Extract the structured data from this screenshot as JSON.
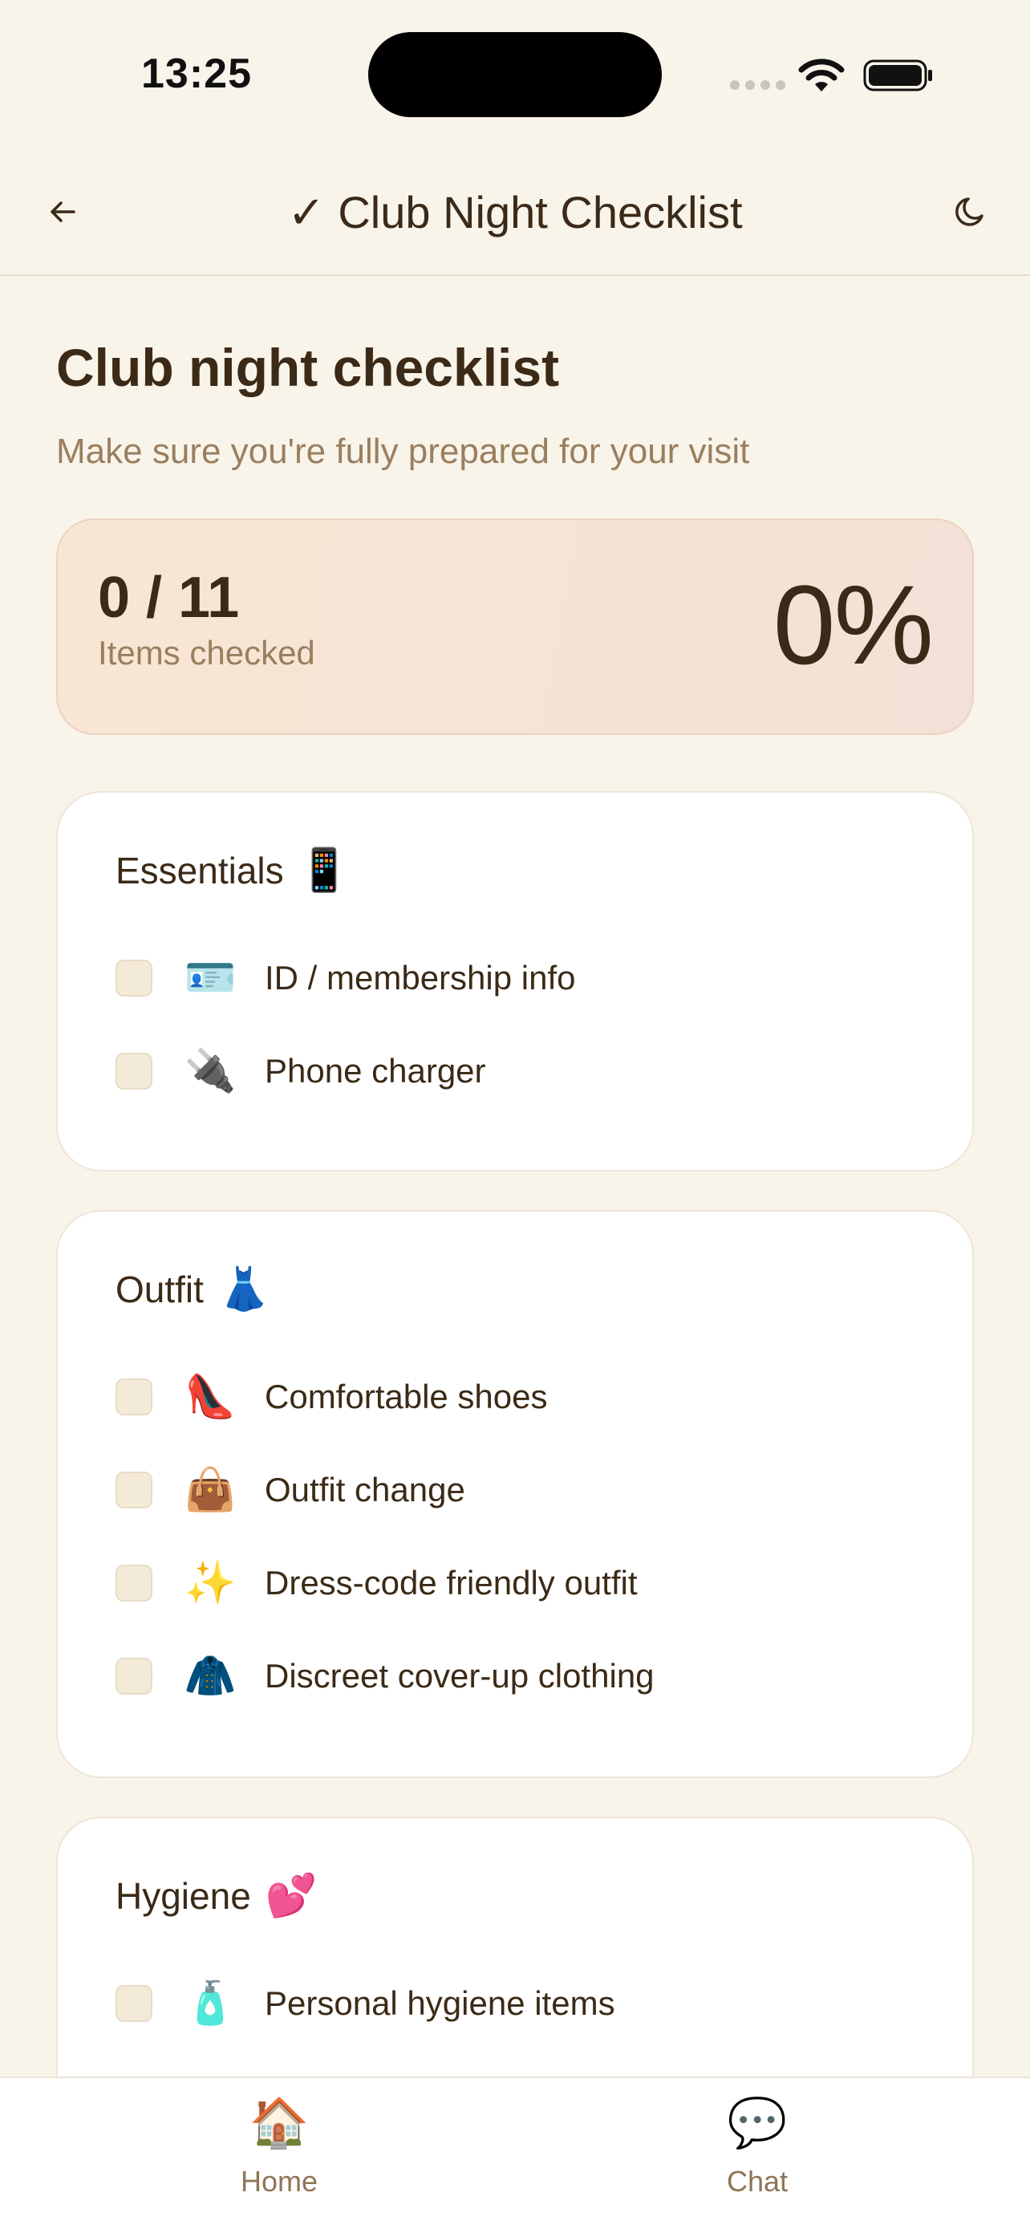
{
  "status_bar": {
    "time": "13:25"
  },
  "header": {
    "check_glyph": "✓",
    "title": "Club Night Checklist",
    "back_icon": "arrow-left-icon",
    "theme_icon": "moon-icon"
  },
  "page": {
    "title": "Club night checklist",
    "subtitle": "Make sure you're fully prepared for your visit"
  },
  "progress": {
    "count": "0 / 11",
    "label": "Items checked",
    "percent": "0%",
    "checked": 0,
    "total": 11
  },
  "categories": [
    {
      "title": "Essentials",
      "emoji": "📱",
      "items": [
        {
          "emoji": "🪪",
          "label": "ID / membership info",
          "checked": false
        },
        {
          "emoji": "🔌",
          "label": "Phone charger",
          "checked": false
        }
      ]
    },
    {
      "title": "Outfit",
      "emoji": "👗",
      "items": [
        {
          "emoji": "👠",
          "label": "Comfortable shoes",
          "checked": false
        },
        {
          "emoji": "👜",
          "label": "Outfit change",
          "checked": false
        },
        {
          "emoji": "✨",
          "label": "Dress-code friendly outfit",
          "checked": false
        },
        {
          "emoji": "🧥",
          "label": "Discreet cover-up clothing",
          "checked": false
        }
      ]
    },
    {
      "title": "Hygiene",
      "emoji": "💕",
      "items": [
        {
          "emoji": "🧴",
          "label": "Personal hygiene items",
          "checked": false
        }
      ]
    }
  ],
  "tabs": [
    {
      "label": "Home",
      "emoji": "🏠"
    },
    {
      "label": "Chat",
      "emoji": "💬"
    }
  ],
  "colors": {
    "background": "#f9f4ea",
    "text": "#3b2a17",
    "muted": "#9a7f5f",
    "checkbox": "#f4ead8"
  }
}
